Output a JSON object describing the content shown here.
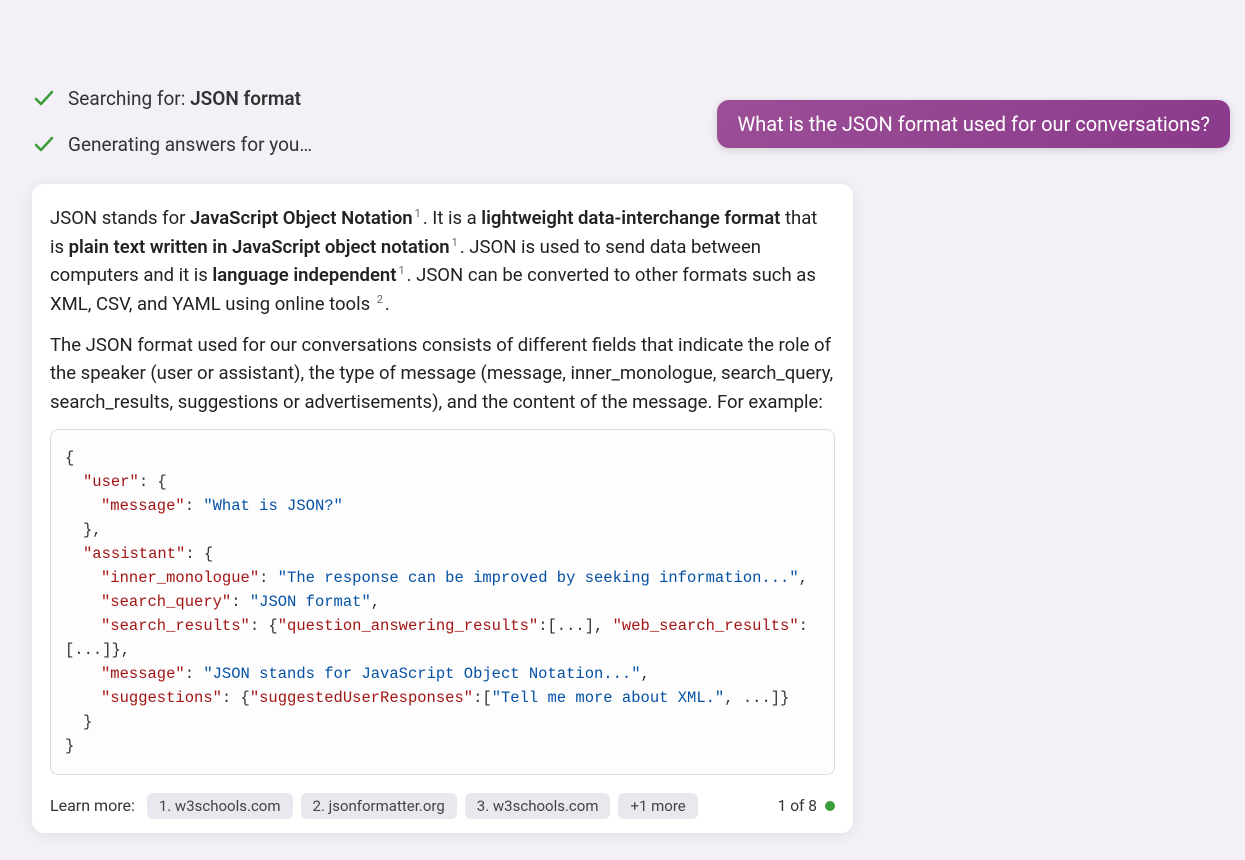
{
  "user_message": "What is the JSON format used for our conversations?",
  "status": {
    "searching_prefix": "Searching for: ",
    "searching_term": "JSON format",
    "generating": "Generating answers for you…"
  },
  "answer": {
    "s1": "JSON stands for ",
    "s2": "JavaScript Object Notation",
    "sup1": "1",
    "s3": ". It is a ",
    "s4": "lightweight data-interchange format",
    "s5": " that is ",
    "s6": "plain text written in JavaScript object notation",
    "sup2": "1",
    "s7": ". JSON is used to send data between computers and it is ",
    "s8": "language independent",
    "sup3": "1",
    "s9": ". JSON can be converted to other formats such as XML, CSV, and YAML using online tools ",
    "sup4": "2",
    "s10": ".",
    "p2": "The JSON format used for our conversations consists of different fields that indicate the role of the speaker (user or assistant), the type of message (message, inner_monologue, search_query, search_results, suggestions or advertisements), and the content of the message. For example:"
  },
  "code": {
    "l1": "{",
    "l2a": "\"user\"",
    "l2b": ": {",
    "l3a": "\"message\"",
    "l3b": ": ",
    "l3c": "\"What is JSON?\"",
    "l4": "},",
    "l5a": "\"assistant\"",
    "l5b": ": {",
    "l6a": "\"inner_monologue\"",
    "l6b": ": ",
    "l6c": "\"The response can be improved by seeking information...\"",
    "l6d": ",",
    "l7a": "\"search_query\"",
    "l7b": ": ",
    "l7c": "\"JSON format\"",
    "l7d": ",",
    "l8a": "\"search_results\"",
    "l8b": ": {",
    "l8c": "\"question_answering_results\"",
    "l8d": ":[...], ",
    "l8e": "\"web_search_results\"",
    "l8f": ": [...]},",
    "l9a": "\"message\"",
    "l9b": ": ",
    "l9c": "\"JSON stands for JavaScript Object Notation...\"",
    "l9d": ",",
    "l10a": "\"suggestions\"",
    "l10b": ": {",
    "l10c": "\"suggestedUserResponses\"",
    "l10d": ":[",
    "l10e": "\"Tell me more about XML.\"",
    "l10f": ", ...]}",
    "l11": "}",
    "l12": "}"
  },
  "learn": {
    "label": "Learn more:",
    "s1": "1. w3schools.com",
    "s2": "2. jsonformatter.org",
    "s3": "3. w3schools.com",
    "more": "+1 more",
    "pager": "1 of 8"
  }
}
